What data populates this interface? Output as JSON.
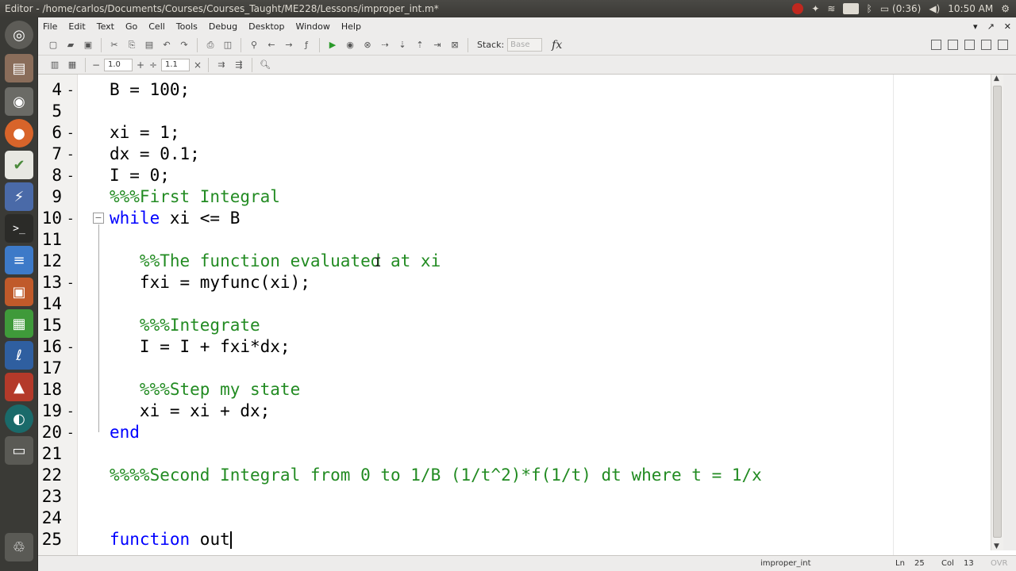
{
  "window_title": "Editor - /home/carlos/Documents/Courses/Courses_Taught/ME228/Lessons/improper_int.m*",
  "tray": {
    "lang": "En",
    "battery": "(0:36)",
    "clock": "10:50 AM"
  },
  "menu": [
    "File",
    "Edit",
    "Text",
    "Go",
    "Cell",
    "Tools",
    "Debug",
    "Desktop",
    "Window",
    "Help"
  ],
  "toolbar": {
    "stack_label": "Stack:",
    "stack_value": "Base",
    "fx_label": "fx"
  },
  "cell_toolbar": {
    "field1": "1.0",
    "field2": "1.1"
  },
  "code_lines": [
    {
      "n": "4",
      "dash": "-",
      "text": "B = 100;",
      "type": "plain"
    },
    {
      "n": "5",
      "dash": "",
      "text": "",
      "type": "plain"
    },
    {
      "n": "6",
      "dash": "-",
      "text": "xi = 1;",
      "type": "plain"
    },
    {
      "n": "7",
      "dash": "-",
      "text": "dx = 0.1;",
      "type": "plain"
    },
    {
      "n": "8",
      "dash": "-",
      "text": "I = 0;",
      "type": "plain"
    },
    {
      "n": "9",
      "dash": "",
      "text": "%%%First Integral",
      "type": "comment"
    },
    {
      "n": "10",
      "dash": "-",
      "text": "while xi <= B",
      "type": "while"
    },
    {
      "n": "11",
      "dash": "",
      "text": "",
      "type": "plain"
    },
    {
      "n": "12",
      "dash": "",
      "text": "   %%The function evaluated at xi",
      "type": "comment"
    },
    {
      "n": "13",
      "dash": "-",
      "text": "   fxi = myfunc(xi);",
      "type": "plain"
    },
    {
      "n": "14",
      "dash": "",
      "text": "",
      "type": "plain"
    },
    {
      "n": "15",
      "dash": "",
      "text": "   %%%Integrate",
      "type": "comment"
    },
    {
      "n": "16",
      "dash": "-",
      "text": "   I = I + fxi*dx;",
      "type": "plain"
    },
    {
      "n": "17",
      "dash": "",
      "text": "",
      "type": "plain"
    },
    {
      "n": "18",
      "dash": "",
      "text": "   %%%Step my state",
      "type": "comment"
    },
    {
      "n": "19",
      "dash": "-",
      "text": "   xi = xi + dx;",
      "type": "plain"
    },
    {
      "n": "20",
      "dash": "-",
      "text": "end",
      "type": "keyword"
    },
    {
      "n": "21",
      "dash": "",
      "text": "",
      "type": "plain"
    },
    {
      "n": "22",
      "dash": "",
      "text": "%%%%Second Integral from 0 to 1/B (1/t^2)*f(1/t) dt where t = 1/x",
      "type": "comment"
    },
    {
      "n": "23",
      "dash": "",
      "text": "",
      "type": "plain"
    },
    {
      "n": "24",
      "dash": "",
      "text": "",
      "type": "plain"
    },
    {
      "n": "25",
      "dash": "",
      "text": "function out",
      "type": "function"
    }
  ],
  "status": {
    "file": "improper_int",
    "ln_label": "Ln",
    "ln_value": "25",
    "col_label": "Col",
    "col_value": "13",
    "ovr": "OVR"
  }
}
